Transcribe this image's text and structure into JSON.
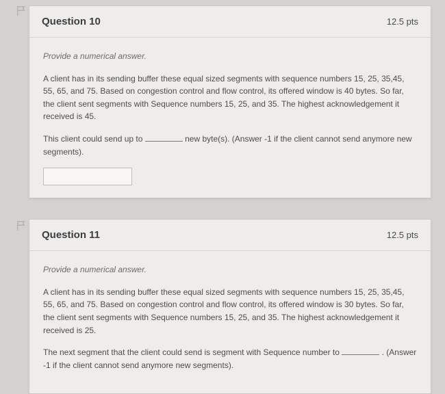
{
  "questions": [
    {
      "title": "Question 10",
      "points": "12.5 pts",
      "instruction": "Provide a numerical answer.",
      "para1": "A client has in its sending buffer these equal sized segments with sequence numbers 15, 25, 35,45, 55, 65, and 75. Based on congestion control and flow control, its offered window is 40 bytes. So far, the client sent segments with Sequence numbers 15, 25, and 35. The highest acknowledgement it received is 45.",
      "para2a": "This client could send up to ",
      "para2b": " new byte(s). (Answer -1 if the client cannot send anymore new segments).",
      "show_input": true
    },
    {
      "title": "Question 11",
      "points": "12.5 pts",
      "instruction": "Provide a numerical answer.",
      "para1": "A client has in its sending buffer these equal sized segments with sequence numbers 15, 25, 35,45, 55, 65, and 75. Based on congestion control and flow control, its offered window is 30 bytes. So far, the client sent segments with Sequence numbers 15, 25, and 35. The highest acknowledgement it received is 25.",
      "para2a": "The next segment that the client could send is segment with Sequence number to ",
      "para2b": " . (Answer -1 if the client cannot send anymore new segments).",
      "show_input": false
    }
  ]
}
